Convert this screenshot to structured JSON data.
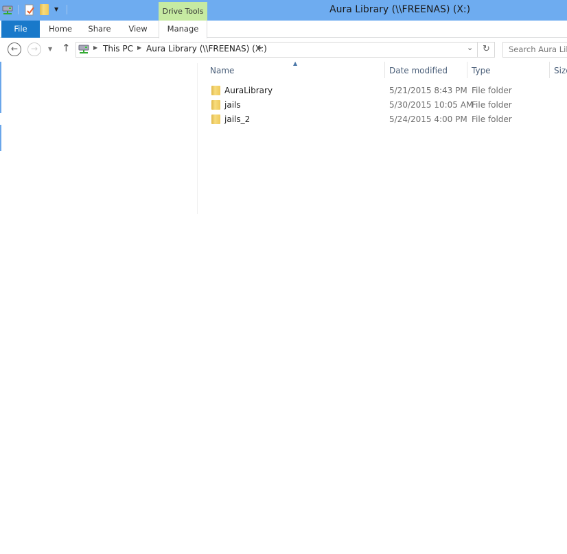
{
  "window": {
    "title": "Aura Library (\\\\FREENAS) (X:)"
  },
  "quick_access": [
    "network-drive-icon",
    "properties-icon",
    "new-folder-icon",
    "customize-dropdown-icon"
  ],
  "ribbon": {
    "contextual_group": "Drive Tools",
    "tabs": [
      {
        "label": "File"
      },
      {
        "label": "Home"
      },
      {
        "label": "Share"
      },
      {
        "label": "View"
      },
      {
        "label": "Manage"
      }
    ]
  },
  "address": {
    "crumbs": [
      "This PC",
      "Aura Library (\\\\FREENAS) (X:)"
    ],
    "search_placeholder": "Search Aura Library"
  },
  "columns": [
    "Name",
    "Date modified",
    "Type",
    "Size"
  ],
  "files": [
    {
      "name": "AuraLibrary",
      "date": "5/21/2015 8:43 PM",
      "type": "File folder"
    },
    {
      "name": "jails",
      "date": "5/30/2015 10:05 AM",
      "type": "File folder"
    },
    {
      "name": "jails_2",
      "date": "5/24/2015 4:00 PM",
      "type": "File folder"
    }
  ],
  "colors": {
    "titlebar": "#6eacf0",
    "file_tab": "#1979ca",
    "drive_tools": "#c6eaa2"
  }
}
